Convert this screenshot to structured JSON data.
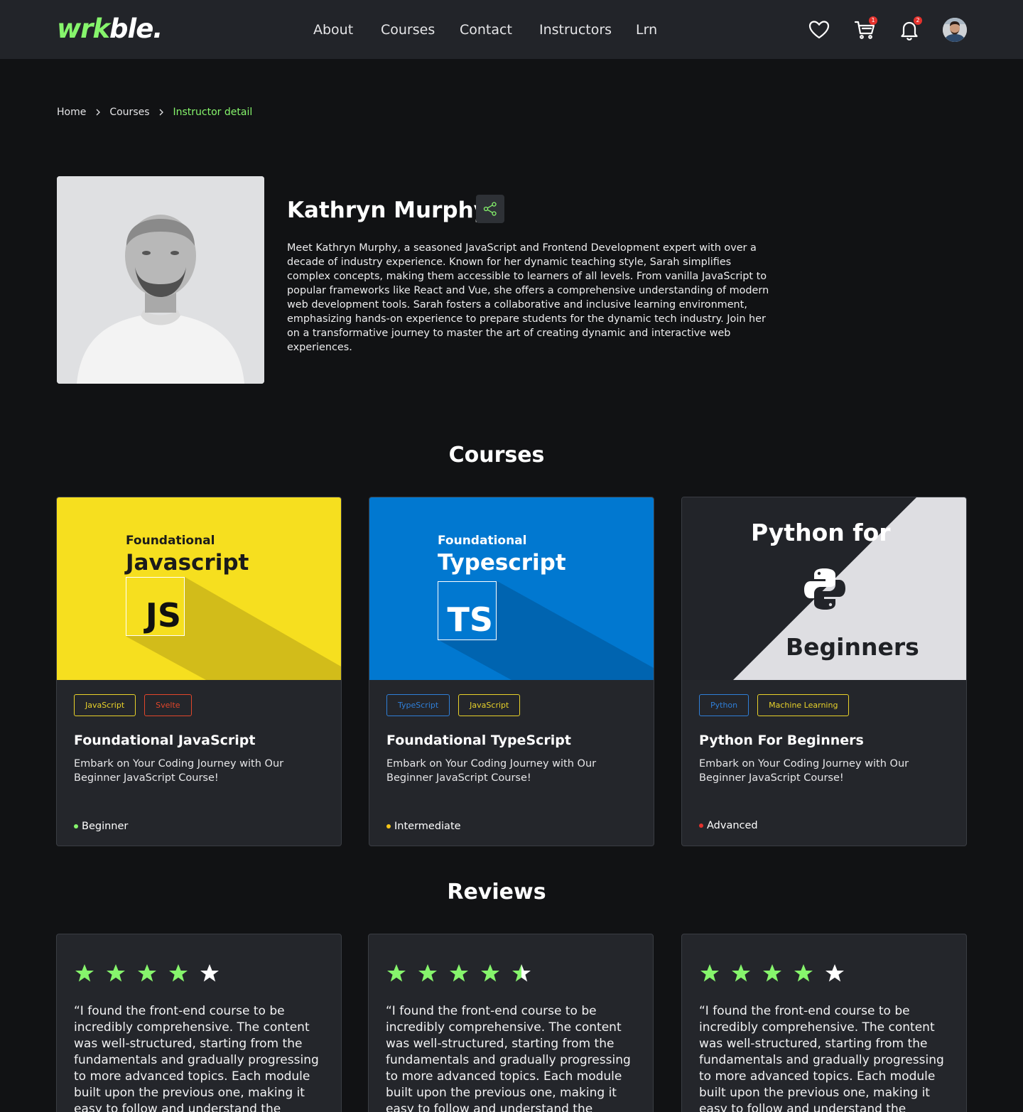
{
  "header": {
    "logo_part1": "wrk",
    "logo_part2": "ble.",
    "nav": [
      "About",
      "Courses",
      "Contact",
      "Instructors",
      "Lrn"
    ],
    "cart_badge": "1",
    "notifications_badge": "2",
    "icons": [
      "heart-icon",
      "cart-icon",
      "bell-icon",
      "user-avatar"
    ]
  },
  "breadcrumb": {
    "home": "Home",
    "courses": "Courses",
    "current": "Instructor detail"
  },
  "instructor": {
    "name": "Kathryn Murphy",
    "bio": "Meet Kathryn Murphy, a seasoned JavaScript and Frontend Development expert with over a decade of industry experience. Known for her dynamic teaching style, Sarah simplifies complex concepts, making them accessible to learners of all levels. From vanilla JavaScript to popular frameworks like React and Vue, she offers a comprehensive understanding of modern web development tools. Sarah fosters a collaborative and inclusive learning environment, emphasizing hands-on experience to prepare students for the dynamic tech industry. Join her on a transformative journey to master the art of creating dynamic and interactive web experiences."
  },
  "courses_section": {
    "title": "Courses",
    "items": [
      {
        "thumb_subtitle": "Foundational",
        "thumb_title": "Javascript",
        "thumb_logo": "JS",
        "tags": [
          {
            "label": "JavaScript",
            "color": "#e9d22a"
          },
          {
            "label": "Svelte",
            "color": "#e2462b"
          }
        ],
        "title": "Foundational JavaScript",
        "description": "Embark on Your Coding Journey with Our Beginner JavaScript Course!",
        "level": "Beginner",
        "level_color": "#86f56c"
      },
      {
        "thumb_subtitle": "Foundational",
        "thumb_title": "Typescript",
        "thumb_logo": "TS",
        "tags": [
          {
            "label": "TypeScript",
            "color": "#2f7fd8"
          },
          {
            "label": "JavaScript",
            "color": "#e9d22a"
          }
        ],
        "title": "Foundational TypeScript",
        "description": "Embark on Your Coding Journey with Our Beginner JavaScript Course!",
        "level": "Intermediate",
        "level_color": "#f5c518"
      },
      {
        "thumb_top": "Python for",
        "thumb_bottom": "Beginners",
        "tags": [
          {
            "label": "Python",
            "color": "#2f7fd8"
          },
          {
            "label": "Machine Learning",
            "color": "#e9d22a"
          }
        ],
        "title": "Python For Beginners",
        "description": "Embark on Your Coding Journey with Our Beginner JavaScript Course!",
        "level": "Advanced",
        "level_color": "#e5322d"
      }
    ]
  },
  "reviews_section": {
    "title": "Reviews",
    "items": [
      {
        "rating": 4,
        "text": "“I found the front-end course to be incredibly comprehensive. The content was well-structured, starting from the fundamentals and gradually progressing to more advanced topics. Each module built upon the previous one, making it easy to follow and understand the concepts.”"
      },
      {
        "rating": 4.5,
        "text": "“I found the front-end course to be incredibly comprehensive. The content was well-structured, starting from the fundamentals and gradually progressing to more advanced topics. Each module built upon the previous one, making it easy to follow and understand the concepts.”"
      },
      {
        "rating": 4,
        "text": "“I found the front-end course to be incredibly comprehensive. The content was well-structured, starting from the fundamentals and gradually progressing to more advanced topics. Each module built upon the previous one, making it easy to follow and understand the concepts.”"
      }
    ]
  },
  "colors": {
    "accent": "#86f56c",
    "header_bg": "#222429",
    "page_bg": "#111214",
    "card_bg": "#24262b",
    "star_filled": "#86f56c",
    "star_empty": "#ffffff"
  }
}
